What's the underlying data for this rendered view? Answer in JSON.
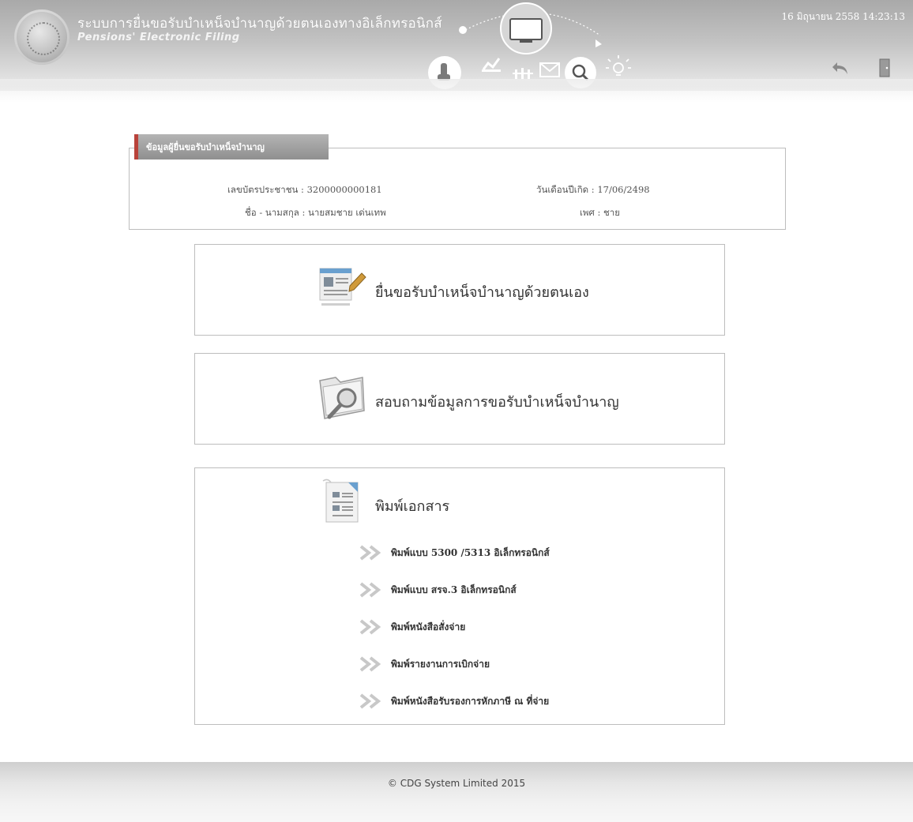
{
  "header": {
    "title": "ระบบการยื่นขอรับบำเหน็จบำนาญด้วยตนเองทางอิเล็กทรอนิกส์",
    "subtitle": "Pensions' Electronic Filing",
    "datetime": "16 มิถุนายน 2558 14:23:13",
    "back_icon": "back-arrow-icon",
    "exit_icon": "exit-door-icon"
  },
  "applicant": {
    "section_title": "ข้อมูลผู้ยื่นขอรับบำเหน็จบำนาญ",
    "id_label": "เลขบัตรประชาชน",
    "id_value": "3200000000181",
    "name_label": "ชื่อ - นามสกุล",
    "name_value": "นายสมชาย เด่นเทพ",
    "dob_label": "วันเดือนปีเกิด",
    "dob_value": "17/06/2498",
    "gender_label": "เพศ",
    "gender_value": "ชาย"
  },
  "menu": {
    "file_pension": "ยื่นขอรับบำเหน็จบำนาญด้วยตนเอง",
    "inquiry": "สอบถามข้อมูลการขอรับบำเหน็จบำนาญ",
    "print_documents": "พิมพ์เอกสาร",
    "print_items": [
      "พิมพ์แบบ 5300 /5313 อิเล็กทรอนิกส์",
      "พิมพ์แบบ สรจ.3 อิเล็กทรอนิกส์",
      "พิมพ์หนังสือสั่งจ่าย",
      "พิมพ์รายงานการเบิกจ่าย",
      "พิมพ์หนังสือรับรองการหักภาษี ณ ที่จ่าย"
    ]
  },
  "footer": {
    "copyright": "© CDG System Limited 2015"
  },
  "colors": {
    "header_gray": "#b5b5b5",
    "tab_accent": "#b9423a",
    "border": "#bdbdbd",
    "chevron": "#c8c8c8"
  }
}
